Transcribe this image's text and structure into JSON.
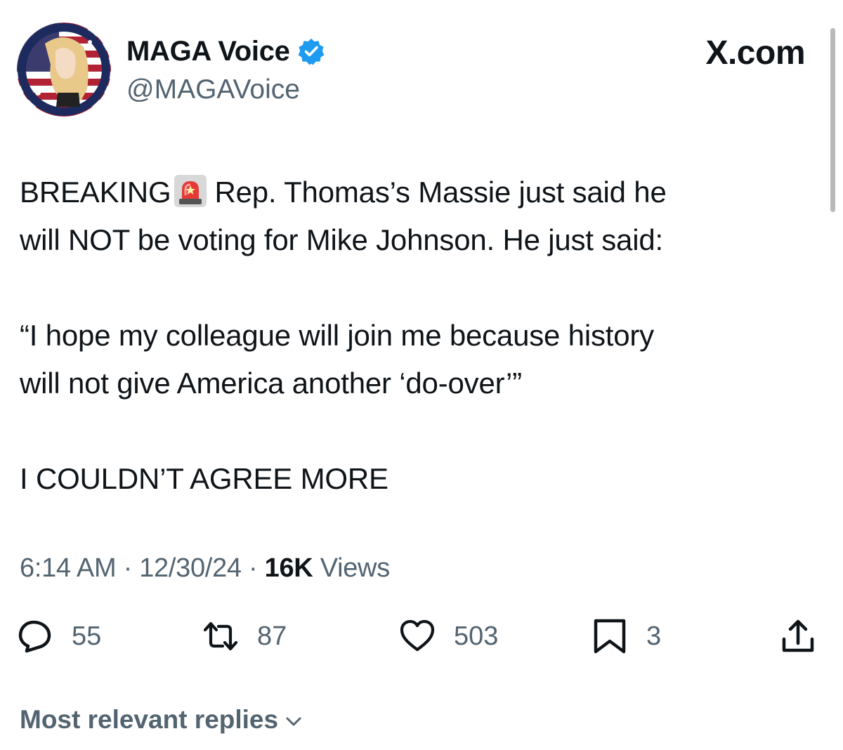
{
  "author": {
    "display_name": "MAGA Voice",
    "handle": "@MAGAVoice",
    "verified": true
  },
  "site_label": "X.com",
  "tweet": {
    "line1_before": "BREAKING",
    "line1_after": "Rep. Thomas’s Massie just said he",
    "line2": "will NOT be voting for Mike Johnson. He just said:",
    "quote_line1": "“I hope my colleague will join me because history",
    "quote_line2": "will not give America another ‘do-over’”",
    "closing": "I COULDN’T AGREE MORE",
    "emoji": "siren-icon"
  },
  "meta": {
    "time": "6:14 AM",
    "date": "12/30/24",
    "views_count": "16K",
    "views_label": "Views",
    "separator": "·"
  },
  "actions": {
    "replies": "55",
    "reposts": "87",
    "likes": "503",
    "bookmarks": "3"
  },
  "replies_filter": "Most relevant replies",
  "colors": {
    "text": "#0f1419",
    "secondary": "#536471",
    "verified": "#1d9bf0"
  }
}
